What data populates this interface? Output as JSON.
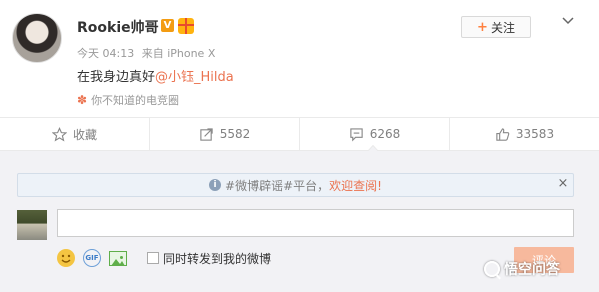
{
  "post": {
    "username": "Rookie帅哥",
    "verified_badge": "V",
    "time": "今天 04:13",
    "source": "来自 iPhone X",
    "text": "在我身边真好",
    "mention": "@小钰_Hilda",
    "topic_source": "你不知道的电竞圈",
    "follow_label": "关注"
  },
  "actions": {
    "favorite": "收藏",
    "repost": "5582",
    "comment": "6268",
    "like": "33583"
  },
  "notice": {
    "text": "#微博辟谣#平台，",
    "link": "欢迎查阅!",
    "close": "×"
  },
  "comment_box": {
    "value": "",
    "repost_label": "同时转发到我的微博",
    "submit_label": "评论"
  },
  "watermark": {
    "text": "悟空问答"
  },
  "colors": {
    "accent": "#eb7350",
    "notice_bg": "#edf2f8",
    "comment_bg": "#f2f2f5",
    "follow_plus": "#ff8140"
  },
  "icons": [
    "gift-icon",
    "dropdown-icon",
    "flower-icon",
    "star-icon",
    "repost-icon",
    "comment-icon",
    "like-icon",
    "info-icon",
    "close-icon",
    "emoji-icon",
    "gif-icon",
    "picture-icon",
    "wukong-icon"
  ]
}
